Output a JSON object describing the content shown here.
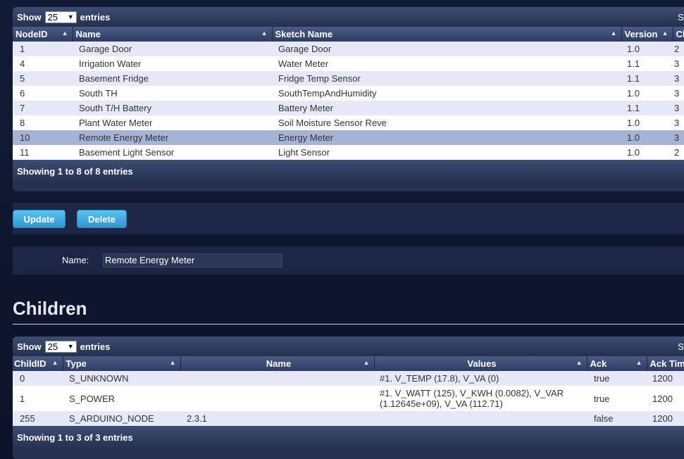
{
  "nodes": {
    "show_label": "Show",
    "entries_value": "25",
    "entries_label": "entries",
    "search_label": "Se",
    "columns": [
      "NodeID",
      "Name",
      "Sketch Name",
      "Version",
      "Cl"
    ],
    "rows": [
      [
        "1",
        "Garage Door",
        "Garage Door",
        "1.0",
        "2"
      ],
      [
        "4",
        "Irrigation Water",
        "Water Meter",
        "1.1",
        "3"
      ],
      [
        "5",
        "Basement Fridge",
        "Fridge Temp Sensor",
        "1.1",
        "3"
      ],
      [
        "6",
        "South TH",
        "SouthTempAndHumidity",
        "1.0",
        "3"
      ],
      [
        "7",
        "South T/H Battery",
        "Battery Meter",
        "1.1",
        "3"
      ],
      [
        "8",
        "Plant Water Meter",
        "Soil Moisture Sensor Reve",
        "1.0",
        "3"
      ],
      [
        "10",
        "Remote Energy Meter",
        "Energy Meter",
        "1.0",
        "3"
      ],
      [
        "11",
        "Basement Light Sensor",
        "Light Sensor",
        "1.0",
        "2"
      ]
    ],
    "selected_row_index": 6,
    "footer": "Showing 1 to 8 of 8 entries"
  },
  "actions": {
    "update_label": "Update",
    "delete_label": "Delete"
  },
  "detail": {
    "name_label": "Name:",
    "name_value": "Remote Energy Meter"
  },
  "children": {
    "title": "Children",
    "show_label": "Show",
    "entries_value": "25",
    "entries_label": "entries",
    "search_label": "Se",
    "columns": [
      "ChildID",
      "Type",
      "Name",
      "Values",
      "Ack",
      "Ack Tim"
    ],
    "rows": [
      [
        "0",
        "S_UNKNOWN",
        "",
        "#1. V_TEMP (17.8), V_VA (0)",
        "true",
        "1200"
      ],
      [
        "1",
        "S_POWER",
        "",
        "#1. V_WATT (125), V_KWH (0.0082), V_VAR (1.12645e+09), V_VA (112.71)",
        "true",
        "1200"
      ],
      [
        "255",
        "S_ARDUINO_NODE",
        "2.3.1",
        "",
        "false",
        "1200"
      ]
    ],
    "footer": "Showing 1 to 3 of 3 entries"
  },
  "colors": {
    "page_bg": "#0f1730",
    "row_odd": "#e5e8f7",
    "row_even": "#ffffff",
    "row_selected": "#a5b3d6",
    "button": "#3aa6dd"
  }
}
